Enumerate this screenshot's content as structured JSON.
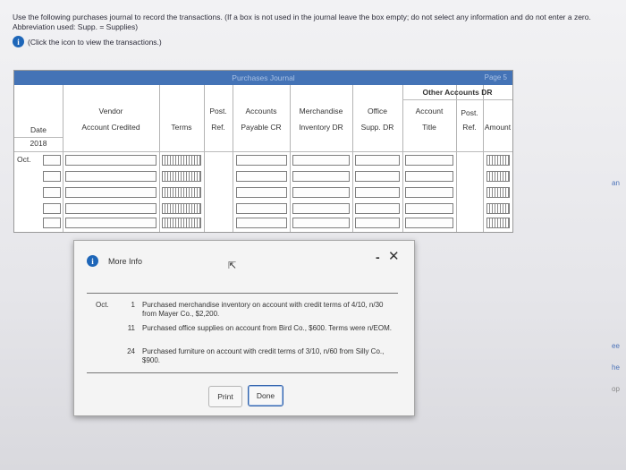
{
  "instructions": {
    "text": "Use the following purchases journal to record the transactions. (If a box is not used in the journal leave the box empty; do not select any information and do not enter a zero. Abbreviation used: Supp. = Supplies)",
    "info_link": "(Click the icon to view the transactions.)"
  },
  "journal": {
    "title": "Purchases Journal",
    "page": "Page 5",
    "other_header": "Other Accounts DR",
    "headers": {
      "date": "Date",
      "vendor_top": "Vendor",
      "vendor_bottom": "Account Credited",
      "terms": "Terms",
      "post_top": "Post.",
      "post_bottom": "Ref.",
      "payable_top": "Accounts",
      "payable_bottom": "Payable CR",
      "merch_top": "Merchandise",
      "merch_bottom": "Inventory DR",
      "office_top": "Office",
      "office_bottom": "Supp. DR",
      "acct_top": "Account",
      "acct_bottom": "Title",
      "post2_top": "Post.",
      "post2_bottom": "Ref.",
      "amount": "Amount"
    },
    "year": "2018",
    "month": "Oct."
  },
  "edge_fragments": [
    "an",
    "ee",
    "he",
    "op"
  ],
  "dialog": {
    "title": "More Info",
    "month": "Oct.",
    "transactions": [
      {
        "day": "1",
        "text": "Purchased merchandise inventory on account with credit terms of 4/10, n/30 from Mayer Co., $2,200."
      },
      {
        "day": "11",
        "text": "Purchased office supplies on account from Bird Co., $600. Terms were n/EOM."
      },
      {
        "day": "24",
        "text": "Purchased furniture on account with credit terms of 3/10, n/60 from Silly Co., $900."
      }
    ],
    "print_label": "Print",
    "done_label": "Done"
  },
  "colors": {
    "accent": "#4473b6",
    "info_icon": "#1e66b8",
    "done_border": "#2d5faa"
  }
}
